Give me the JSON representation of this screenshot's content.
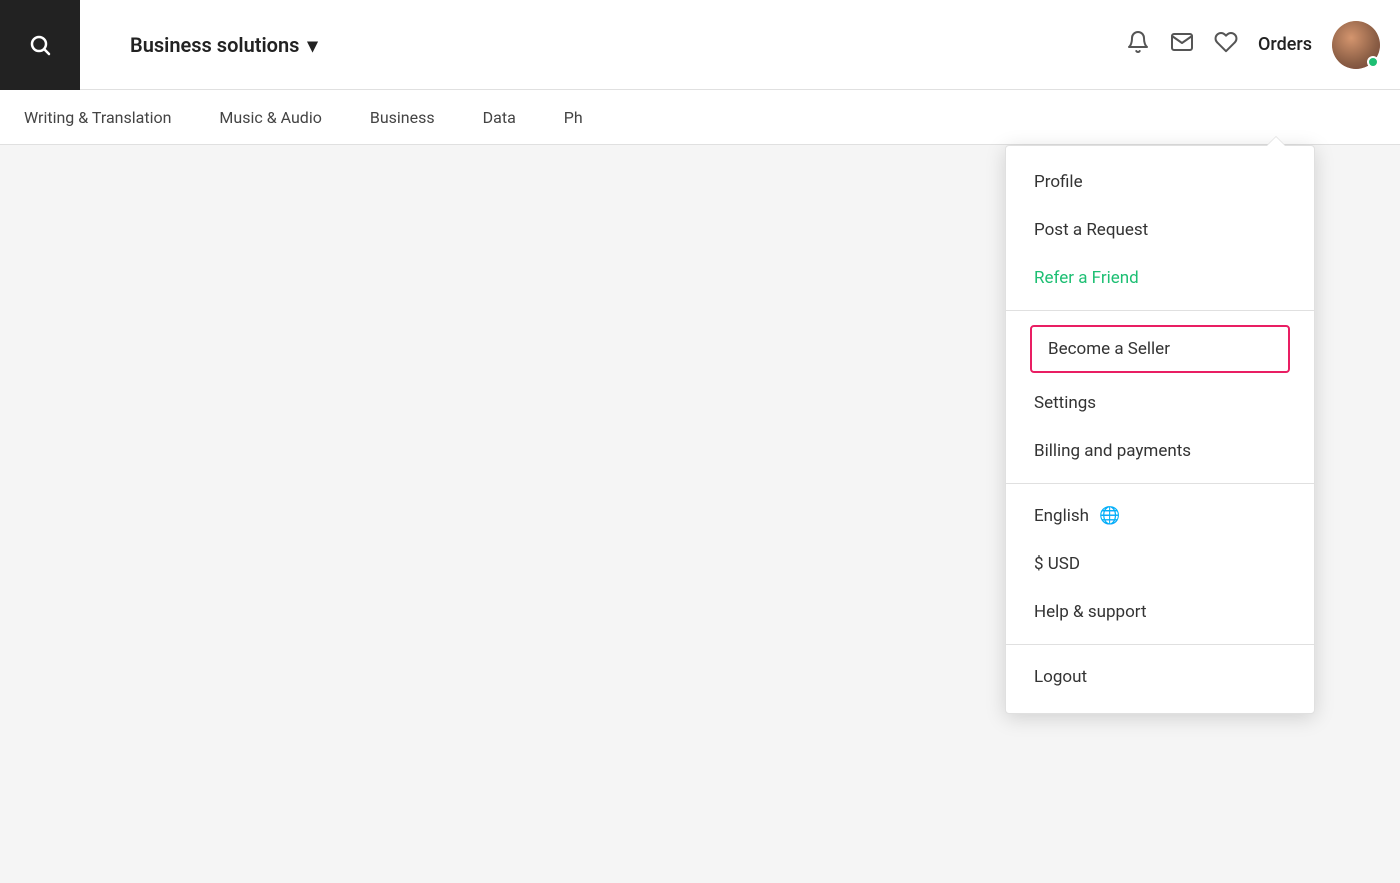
{
  "header": {
    "business_solutions_label": "Business solutions",
    "orders_label": "Orders"
  },
  "nav": {
    "items": [
      {
        "label": "Writing & Translation"
      },
      {
        "label": "Music & Audio"
      },
      {
        "label": "Business"
      },
      {
        "label": "Data"
      },
      {
        "label": "Ph"
      }
    ]
  },
  "dropdown": {
    "arrow_label": "dropdown-caret",
    "items": [
      {
        "id": "profile",
        "label": "Profile",
        "style": "normal",
        "divider_after": false
      },
      {
        "id": "post-request",
        "label": "Post a Request",
        "style": "normal",
        "divider_after": false
      },
      {
        "id": "refer-friend",
        "label": "Refer a Friend",
        "style": "green",
        "divider_after": true
      },
      {
        "id": "become-seller",
        "label": "Become a Seller",
        "style": "highlighted",
        "divider_after": false
      },
      {
        "id": "settings",
        "label": "Settings",
        "style": "normal",
        "divider_after": false
      },
      {
        "id": "billing",
        "label": "Billing and payments",
        "style": "normal",
        "divider_after": true
      },
      {
        "id": "english",
        "label": "English",
        "style": "normal",
        "has_globe": true,
        "divider_after": false
      },
      {
        "id": "currency",
        "label": "$ USD",
        "style": "normal",
        "divider_after": false
      },
      {
        "id": "help",
        "label": "Help & support",
        "style": "normal",
        "divider_after": true
      },
      {
        "id": "logout",
        "label": "Logout",
        "style": "normal",
        "divider_after": false
      }
    ]
  }
}
